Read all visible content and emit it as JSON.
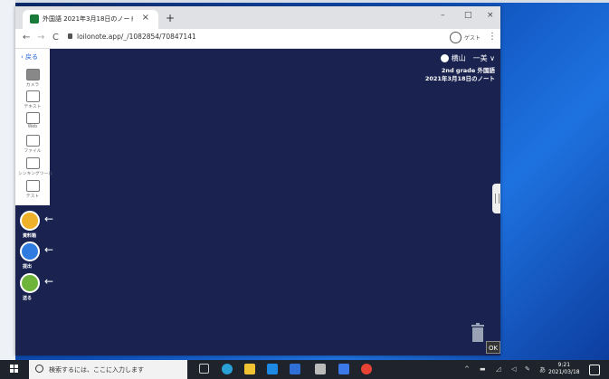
{
  "browser": {
    "tab_title": "外国語 2021年3月18日のノート",
    "new_tab": "+",
    "close_tab": "×",
    "url": "loilonote.app/_/1082854/70847141",
    "profile_label": "ゲスト",
    "win_minimize": "–",
    "win_maximize": "□",
    "win_close": "×",
    "nav_back": "←",
    "nav_forward": "→",
    "nav_reload": "C",
    "menu": "⋮"
  },
  "app": {
    "back_label": "戻る",
    "tools": [
      {
        "label": "カメラ",
        "icon": "camera-icon"
      },
      {
        "label": "テキスト",
        "icon": "text-icon"
      },
      {
        "label": "Web",
        "icon": "web-icon"
      },
      {
        "label": "ファイル",
        "icon": "file-icon"
      },
      {
        "label": "シンキングツール",
        "icon": "thinking-tool-icon"
      },
      {
        "label": "テスト",
        "icon": "test-icon"
      }
    ],
    "circle_buttons": [
      {
        "label": "資料箱",
        "icon": "materials-box-icon"
      },
      {
        "label": "提出",
        "icon": "submit-icon"
      },
      {
        "label": "送る",
        "icon": "send-icon"
      }
    ],
    "user_name": "横山　一美",
    "class_name": "2nd grade 外国語",
    "note_title": "2021年3月18日のノート",
    "ok_label": "OK",
    "arrow": "←",
    "dropdown": "∨"
  },
  "taskbar": {
    "search_placeholder": "検索するには、ここに入力します",
    "time": "9:21",
    "date": "2021/03/18",
    "ime_label": "あ"
  },
  "colors": {
    "app_bg": "#1a2350",
    "accent": "#1e5fd6",
    "circle_button": "#f0b12a"
  }
}
